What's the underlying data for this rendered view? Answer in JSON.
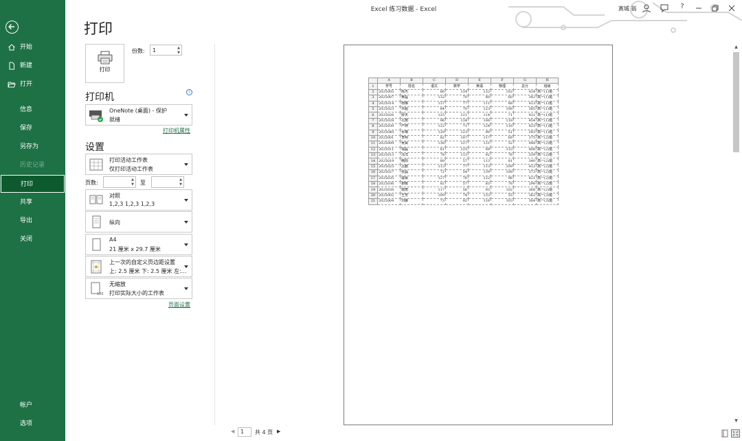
{
  "window": {
    "title": "Excel 练习数据  -  Excel",
    "user": "寅城 翁"
  },
  "sidebar": {
    "items": [
      {
        "label": "开始",
        "icon": "home-icon"
      },
      {
        "label": "新建",
        "icon": "new-file-icon"
      },
      {
        "label": "打开",
        "icon": "folder-open-icon"
      },
      {
        "label": "信息"
      },
      {
        "label": "保存"
      },
      {
        "label": "另存为"
      },
      {
        "label": "历史记录"
      },
      {
        "label": "打印"
      },
      {
        "label": "共享"
      },
      {
        "label": "导出"
      },
      {
        "label": "关闭"
      }
    ],
    "bottom": [
      {
        "label": "帐户"
      },
      {
        "label": "选项"
      }
    ]
  },
  "page_title": "打印",
  "print": {
    "button_label": "打印",
    "copies_label": "份数:",
    "copies_value": "1"
  },
  "printer": {
    "heading": "打印机",
    "name": "OneNote (桌面) - 保护",
    "status": "就绪",
    "properties_link": "打印机属性"
  },
  "settings": {
    "heading": "设置",
    "scope": {
      "line1": "打印活动工作表",
      "line2": "仅打印活动工作表"
    },
    "pages_label": "页数:",
    "to_label": "至",
    "collate": {
      "line1": "对照",
      "line2": "1,2,3    1,2,3    1,2,3"
    },
    "orientation": {
      "line1": "纵向"
    },
    "paper": {
      "line1": "A4",
      "line2": "21 厘米 x 29.7 厘米"
    },
    "margins": {
      "line1": "上一次的自定义页边距设置",
      "line2": "上: 2.5 厘米 下: 2.5 厘米 左:..."
    },
    "scaling": {
      "line1": "无缩放",
      "line2": "打印实际大小的工作表"
    },
    "page_setup_link": "页面设置"
  },
  "pager": {
    "current": "1",
    "total": "共 4 页"
  },
  "sheet": {
    "col_letters": [
      "A",
      "B",
      "C",
      "D",
      "E",
      "F",
      "G",
      "H"
    ],
    "headers": [
      "学号",
      "姓名",
      "语文",
      "数学",
      "英语",
      "物理",
      "总分",
      "班级"
    ],
    "rows": [
      [
        "2025005",
        "陈杰",
        "66",
        "134",
        "132",
        "102",
        "434",
        "高一(1)班"
      ],
      [
        "2025007",
        "黄磊",
        "132",
        "70",
        "80",
        "60",
        "342",
        "高一(1)班"
      ],
      [
        "2025014",
        "杨琳",
        "137",
        "77",
        "111",
        "88",
        "413",
        "高一(1)班"
      ],
      [
        "2025023",
        "许超",
        "84",
        "70",
        "123",
        "108",
        "385",
        "高一(1)班"
      ],
      [
        "2025026",
        "廖天",
        "125",
        "121",
        "114",
        "71",
        "431",
        "高一(1)班"
      ],
      [
        "2025028",
        "孔丽",
        "96",
        "134",
        "106",
        "118",
        "454",
        "高一(1)班"
      ],
      [
        "2025030",
        "严婷",
        "122",
        "71",
        "124",
        "116",
        "433",
        "高一(1)班"
      ],
      [
        "2025040",
        "水琳",
        "129",
        "123",
        "90",
        "51",
        "393",
        "高一(1)班"
      ],
      [
        "2025001",
        "李明",
        "82",
        "107",
        "117",
        "69",
        "375",
        "高一(2)班"
      ],
      [
        "2025009",
        "吴昊",
        "138",
        "127",
        "131",
        "52",
        "448",
        "高一(2)班"
      ],
      [
        "2025011",
        "钱磊",
        "81",
        "125",
        "69",
        "133",
        "408",
        "高一(2)班"
      ],
      [
        "2025013",
        "冯洋",
        "78",
        "113",
        "92",
        "76",
        "339",
        "高一(2)班"
      ],
      [
        "2025019",
        "韩阳",
        "89",
        "57",
        "113",
        "81",
        "340",
        "高一(2)班"
      ],
      [
        "2025025",
        "吕鹏",
        "113",
        "77",
        "113",
        "109",
        "412",
        "高一(2)班"
      ],
      [
        "2025027",
        "张磊",
        "72",
        "54",
        "139",
        "108",
        "373",
        "高一(2)班"
      ],
      [
        "2025035",
        "戚昊",
        "127",
        "76",
        "122",
        "96",
        "421",
        "高一(2)班"
      ],
      [
        "2025036",
        "谢敏",
        "82",
        "57",
        "83",
        "76",
        "298",
        "高一(2)班"
      ],
      [
        "2025038",
        "喻丽",
        "117",
        "56",
        "93",
        "102",
        "368",
        "高一(2)班"
      ],
      [
        "2025002",
        "王芳",
        "109",
        "74",
        "133",
        "55",
        "362",
        "高一(3)班"
      ],
      [
        "2025004",
        "刘娜",
        "73",
        "92",
        "116",
        "103",
        "384",
        "高一(3)班"
      ]
    ]
  }
}
